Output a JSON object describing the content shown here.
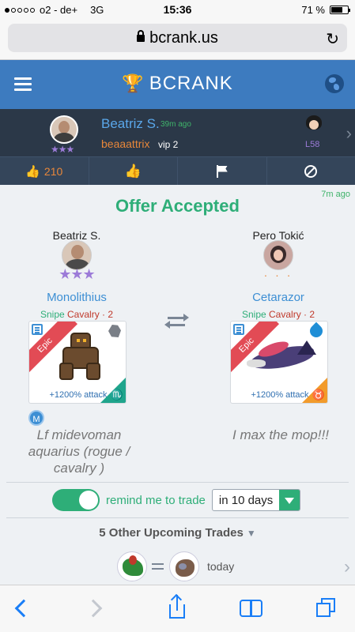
{
  "status_bar": {
    "carrier": "o2 - de+",
    "network": "3G",
    "time": "15:36",
    "battery": "71 %",
    "battery_level": 0.71
  },
  "browser": {
    "url": "bcrank.us"
  },
  "app": {
    "brand": "BCRANK"
  },
  "user_card": {
    "name": "Beatriz S.",
    "time": "39m ago",
    "handle": "beaaattrix",
    "vip": "vip 2",
    "level": "L58",
    "stars": "★★★"
  },
  "actions": {
    "likes": "210"
  },
  "offer": {
    "ago": "7m ago",
    "title": "Offer Accepted",
    "left": {
      "player": "Beatriz S.",
      "stars": "★★★",
      "monster": "Monolithius",
      "role": "Snipe",
      "class": "Cavalry · 2",
      "rarity": "Epic",
      "bonus": "+1200% attack",
      "zodiac": "♏",
      "badge": "M",
      "note": "Lf midevoman aquarius (rogue / cavalry )"
    },
    "right": {
      "player": "Pero Tokić",
      "dots": "· · ·",
      "monster": "Cetarazor",
      "role": "Snipe",
      "class": "Cavalry · 2",
      "rarity": "Epic",
      "bonus": "+1200% attack",
      "zodiac": "♉",
      "note": "I max the mop!!!"
    }
  },
  "reminder": {
    "label": "remind me to trade",
    "selected": "in 10 days",
    "enabled": true
  },
  "upcoming": {
    "label": "5 Other Upcoming Trades",
    "arrow": "▼",
    "when": "today"
  },
  "icons": [
    "menu-icon",
    "trophy-icon",
    "globe-icon",
    "thumbs-up-icon",
    "flag-icon",
    "block-icon",
    "swap-icon",
    "chevron-right-icon",
    "lock-icon",
    "reload-icon",
    "back-icon",
    "forward-icon",
    "share-icon",
    "bookmarks-icon",
    "tabs-icon"
  ],
  "colors": {
    "header": "#3d7bbf",
    "accent_green": "#2eae78",
    "link_blue": "#3d8fd4",
    "orange": "#e8873a",
    "epic_red": "#e24b55"
  }
}
